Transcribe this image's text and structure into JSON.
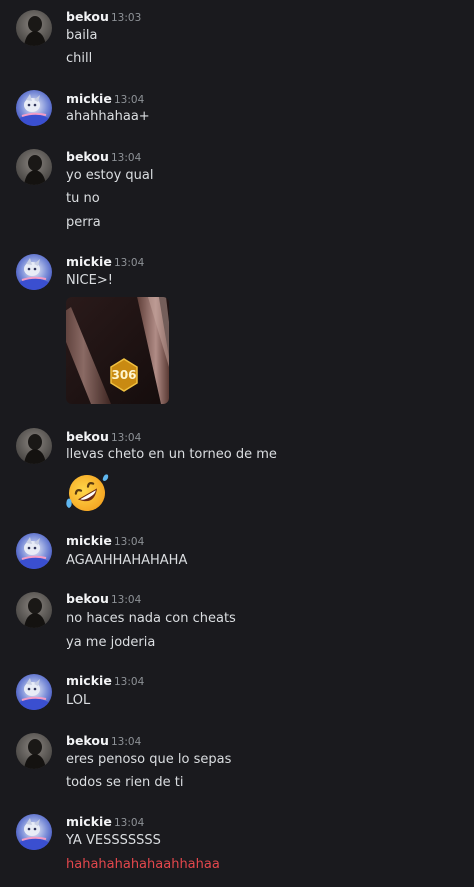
{
  "colors": {
    "background": "#1a1a1e",
    "username": "#f2f3f5",
    "message_text": "#dbdee1",
    "timestamp": "#8e9297",
    "highlight_text": "#e3474c"
  },
  "users": {
    "bekou": {
      "name": "bekou",
      "avatar_icon": "dark-silhouette-avatar"
    },
    "mickie": {
      "name": "mickie",
      "avatar_icon": "blue-anime-character-avatar"
    }
  },
  "groups": [
    {
      "author": "bekou",
      "time": "13:03",
      "lines": [
        "baila",
        "chill"
      ]
    },
    {
      "author": "mickie",
      "time": "13:04",
      "lines": [
        "ahahhahaa+"
      ]
    },
    {
      "author": "bekou",
      "time": "13:04",
      "lines": [
        "yo estoy qual",
        "tu no",
        "perra"
      ]
    },
    {
      "author": "mickie",
      "time": "13:04",
      "lines": [
        "NICE>!"
      ],
      "attachment": {
        "type": "gif",
        "badge_text": "306"
      }
    },
    {
      "author": "bekou",
      "time": "13:04",
      "lines": [
        "llevas cheto en un torneo de me"
      ],
      "emoji": "rolling-on-floor-laughing-emoji"
    },
    {
      "author": "mickie",
      "time": "13:04",
      "lines": [
        "AGAAHHAHAHAHA"
      ]
    },
    {
      "author": "bekou",
      "time": "13:04",
      "lines": [
        "no haces nada con cheats",
        "ya me joderia"
      ]
    },
    {
      "author": "mickie",
      "time": "13:04",
      "lines": [
        "LOL"
      ]
    },
    {
      "author": "bekou",
      "time": "13:04",
      "lines": [
        "eres penoso que lo sepas",
        "todos se rien de ti"
      ]
    },
    {
      "author": "mickie",
      "time": "13:04",
      "lines": [
        "YA VESSSSSSS",
        "hahahahahahaahhahaa"
      ]
    }
  ]
}
